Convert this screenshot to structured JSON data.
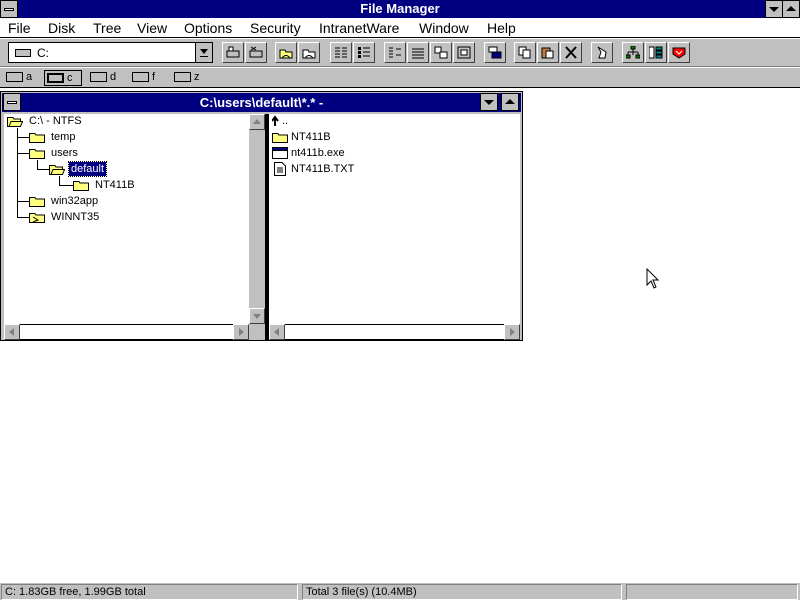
{
  "app": {
    "title": "File Manager"
  },
  "menu": [
    "File",
    "Disk",
    "Tree",
    "View",
    "Options",
    "Security",
    "IntranetWare",
    "Window",
    "Help"
  ],
  "toolbar": {
    "drive_value": "C:",
    "buttons": [
      "connect-network-drive-icon",
      "disconnect-network-drive-icon",
      "share-as-icon",
      "stop-sharing-icon",
      "large-icons-icon",
      "small-icons-icon",
      "list-icon",
      "details-icon",
      "sort-by-name-icon",
      "sort-by-type-icon",
      "new-window-icon",
      "copy-icon",
      "paste-icon",
      "delete-icon",
      "properties-icon",
      "network-icon",
      "tree-icon",
      "help-icon"
    ]
  },
  "drives": [
    {
      "letter": "a",
      "icon": "floppy-drive-icon",
      "selected": false
    },
    {
      "letter": "c",
      "icon": "hard-drive-icon",
      "selected": true
    },
    {
      "letter": "d",
      "icon": "cdrom-drive-icon",
      "selected": false
    },
    {
      "letter": "f",
      "icon": "network-drive-icon",
      "selected": false
    },
    {
      "letter": "z",
      "icon": "network-drive-icon",
      "selected": false
    }
  ],
  "window": {
    "title": "C:\\users\\default\\*.* -"
  },
  "tree": [
    {
      "label": "C:\\ - NTFS",
      "level": 0,
      "icon": "open-folder-icon",
      "selected": false
    },
    {
      "label": "temp",
      "level": 1,
      "icon": "folder-icon",
      "selected": false
    },
    {
      "label": "users",
      "level": 1,
      "icon": "folder-icon",
      "selected": false
    },
    {
      "label": "default",
      "level": 2,
      "icon": "open-folder-icon",
      "selected": true
    },
    {
      "label": "NT411B",
      "level": 3,
      "icon": "folder-icon",
      "selected": false
    },
    {
      "label": "win32app",
      "level": 1,
      "icon": "folder-icon",
      "selected": false
    },
    {
      "label": "WINNT35",
      "level": 1,
      "icon": "folder-icon",
      "selected": false
    }
  ],
  "files": [
    {
      "label": "..",
      "icon": "up-folder-icon"
    },
    {
      "label": "NT411B",
      "icon": "folder-icon"
    },
    {
      "label": "nt411b.exe",
      "icon": "program-file-icon"
    },
    {
      "label": "NT411B.TXT",
      "icon": "document-file-icon"
    }
  ],
  "status": {
    "left": "C: 1.83GB free,  1.99GB total",
    "right": "Total 3 file(s) (10.4MB)"
  },
  "colors": {
    "titlebar": "#000080",
    "face": "#c0c0c0",
    "folder": "#ffff80",
    "selection": "#000080"
  }
}
